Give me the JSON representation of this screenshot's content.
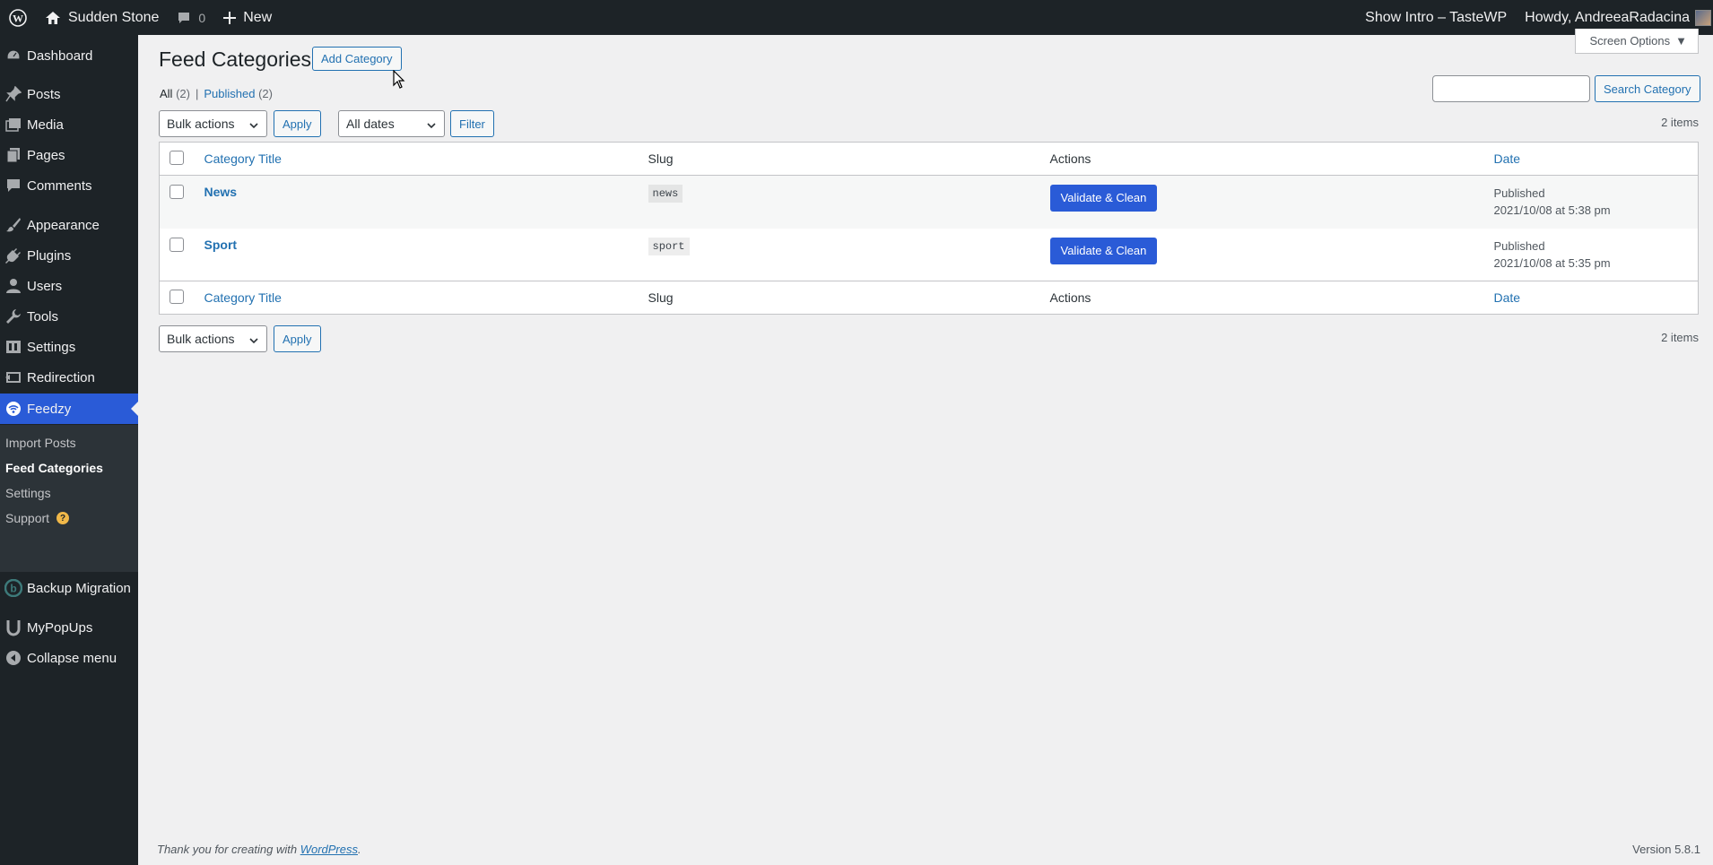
{
  "adminbar": {
    "site_name": "Sudden Stone",
    "comments_count": "0",
    "new_label": "New",
    "show_intro": "Show Intro – TasteWP",
    "howdy": "Howdy, AndreeaRadacina"
  },
  "sidebar": {
    "items": [
      {
        "label": "Dashboard",
        "icon": "dashboard-icon"
      },
      {
        "label": "Posts",
        "icon": "pin-icon"
      },
      {
        "label": "Media",
        "icon": "media-icon"
      },
      {
        "label": "Pages",
        "icon": "pages-icon"
      },
      {
        "label": "Comments",
        "icon": "comment-icon"
      },
      {
        "label": "Appearance",
        "icon": "brush-icon"
      },
      {
        "label": "Plugins",
        "icon": "plug-icon"
      },
      {
        "label": "Users",
        "icon": "user-icon"
      },
      {
        "label": "Tools",
        "icon": "wrench-icon"
      },
      {
        "label": "Settings",
        "icon": "settings-icon"
      },
      {
        "label": "Redirection",
        "icon": "redirect-icon"
      },
      {
        "label": "Feedzy",
        "icon": "feedzy-icon"
      },
      {
        "label": "Backup Migration",
        "icon": "backup-icon"
      },
      {
        "label": "MyPopUps",
        "icon": "mypopups-icon"
      },
      {
        "label": "Collapse menu",
        "icon": "collapse-icon"
      }
    ],
    "submenu": [
      "Import Posts",
      "Feed Categories",
      "Settings",
      "Support"
    ],
    "support_badge": "?"
  },
  "screen_options": "Screen Options",
  "page": {
    "title": "Feed Categories",
    "add_button": "Add Category"
  },
  "filters": {
    "all_label": "All",
    "all_count": "(2)",
    "separator": "|",
    "published_label": "Published",
    "published_count": "(2)",
    "bulk_actions": "Bulk actions",
    "apply": "Apply",
    "all_dates": "All dates",
    "filter": "Filter",
    "search_button": "Search Category",
    "items_count": "2 items"
  },
  "table": {
    "columns": [
      "Category Title",
      "Slug",
      "Actions",
      "Date"
    ],
    "rows": [
      {
        "title": "News",
        "slug": "news",
        "action": "Validate & Clean",
        "status": "Published",
        "date": "2021/10/08 at 5:38 pm"
      },
      {
        "title": "Sport",
        "slug": "sport",
        "action": "Validate & Clean",
        "status": "Published",
        "date": "2021/10/08 at 5:35 pm"
      }
    ]
  },
  "footer": {
    "thanks": "Thank you for creating with",
    "wordpress": "WordPress",
    "period": ".",
    "version": "Version 5.8.1"
  }
}
